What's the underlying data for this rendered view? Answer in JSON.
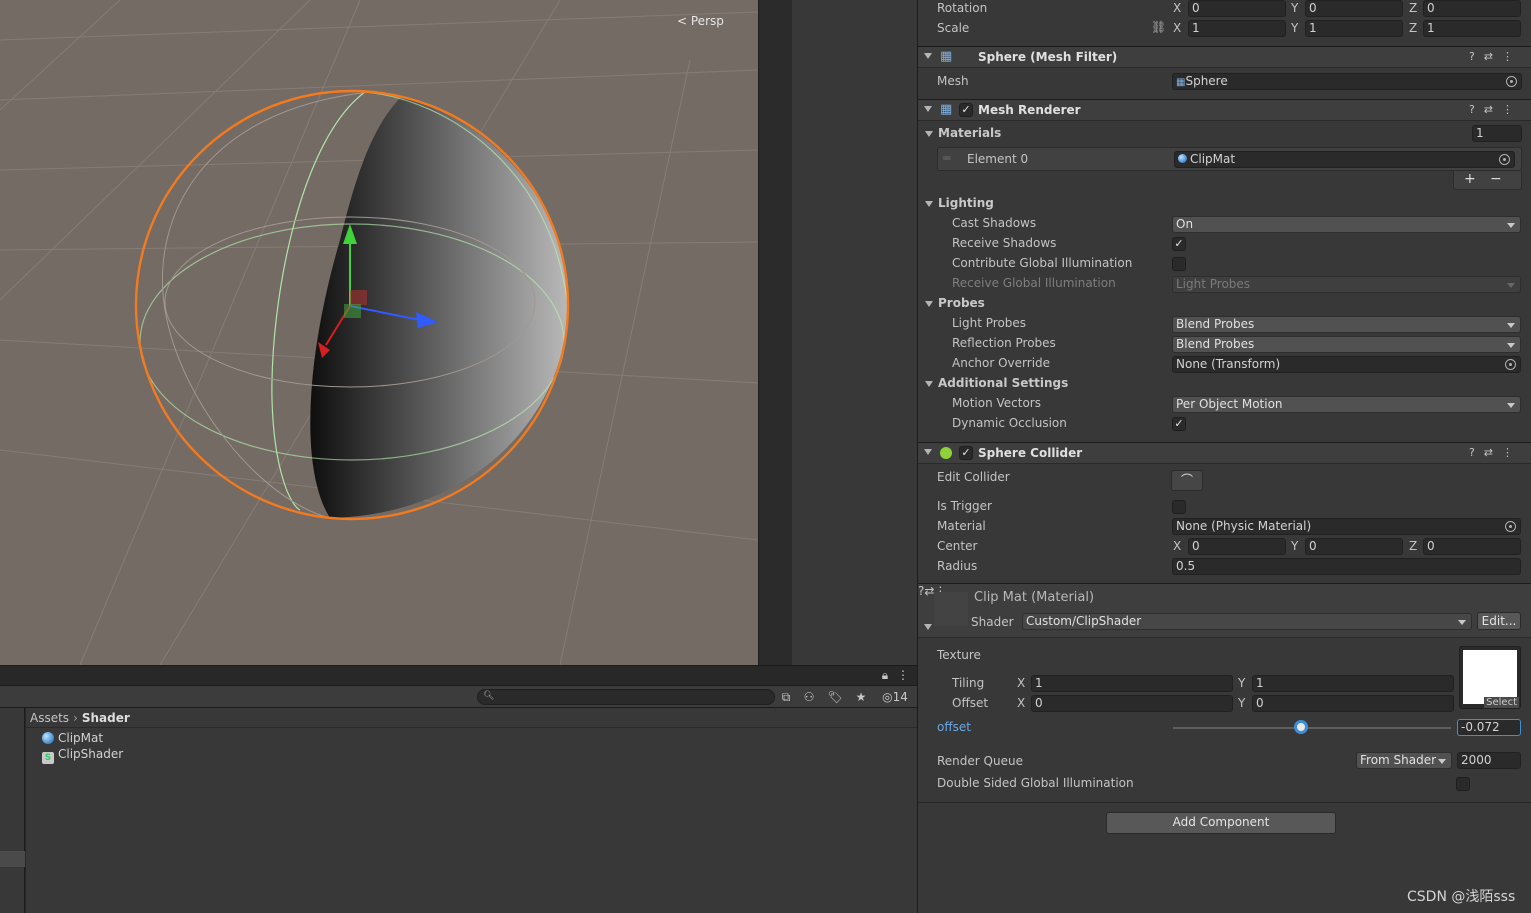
{
  "scene": {
    "projection_label": "Persp"
  },
  "project": {
    "hidden_count": "14",
    "breadcrumb": {
      "root": "Assets",
      "current": "Shader"
    },
    "files": [
      {
        "name": "ClipMat",
        "icon": "material-icon"
      },
      {
        "name": "ClipShader",
        "icon": "shader-icon"
      }
    ]
  },
  "inspector": {
    "transform": {
      "rotation_label": "Rotation",
      "rotation": {
        "x": "0",
        "y": "0",
        "z": "0"
      },
      "scale_label": "Scale",
      "scale": {
        "x": "1",
        "y": "1",
        "z": "1"
      }
    },
    "mesh_filter": {
      "title": "Sphere (Mesh Filter)",
      "mesh_label": "Mesh",
      "mesh_value": "Sphere"
    },
    "mesh_renderer": {
      "title": "Mesh Renderer",
      "materials_label": "Materials",
      "materials_count": "1",
      "element_label": "Element 0",
      "element_value": "ClipMat",
      "lighting_label": "Lighting",
      "cast_shadows_label": "Cast Shadows",
      "cast_shadows_value": "On",
      "receive_shadows_label": "Receive Shadows",
      "contribute_gi_label": "Contribute Global Illumination",
      "receive_gi_label": "Receive Global Illumination",
      "receive_gi_value": "Light Probes",
      "probes_label": "Probes",
      "light_probes_label": "Light Probes",
      "light_probes_value": "Blend Probes",
      "reflection_probes_label": "Reflection Probes",
      "reflection_probes_value": "Blend Probes",
      "anchor_override_label": "Anchor Override",
      "anchor_override_value": "None (Transform)",
      "additional_label": "Additional Settings",
      "motion_vectors_label": "Motion Vectors",
      "motion_vectors_value": "Per Object Motion",
      "dynamic_occlusion_label": "Dynamic Occlusion"
    },
    "sphere_collider": {
      "title": "Sphere Collider",
      "edit_collider_label": "Edit Collider",
      "is_trigger_label": "Is Trigger",
      "material_label": "Material",
      "material_value": "None (Physic Material)",
      "center_label": "Center",
      "center": {
        "x": "0",
        "y": "0",
        "z": "0"
      },
      "radius_label": "Radius",
      "radius_value": "0.5"
    },
    "material": {
      "title": "Clip Mat (Material)",
      "shader_label": "Shader",
      "shader_value": "Custom/ClipShader",
      "edit_label": "Edit...",
      "texture_label": "Texture",
      "select_label": "Select",
      "tiling_label": "Tiling",
      "tiling": {
        "x": "1",
        "y": "1"
      },
      "offset_label": "Offset",
      "offset": {
        "x": "0",
        "y": "0"
      },
      "offset_prop_label": "offset",
      "offset_prop_value": "-0.072",
      "offset_slider_fraction": 0.46,
      "render_queue_label": "Render Queue",
      "render_queue_mode": "From Shader",
      "render_queue_value": "2000",
      "double_sided_gi_label": "Double Sided Global Illumination"
    },
    "add_component_label": "Add Component"
  },
  "watermark": "CSDN @浅陌sss",
  "colors": {
    "accent": "#3d8fd9",
    "selection_outline": "#f47a1f",
    "scene_bg": "#736b64"
  }
}
